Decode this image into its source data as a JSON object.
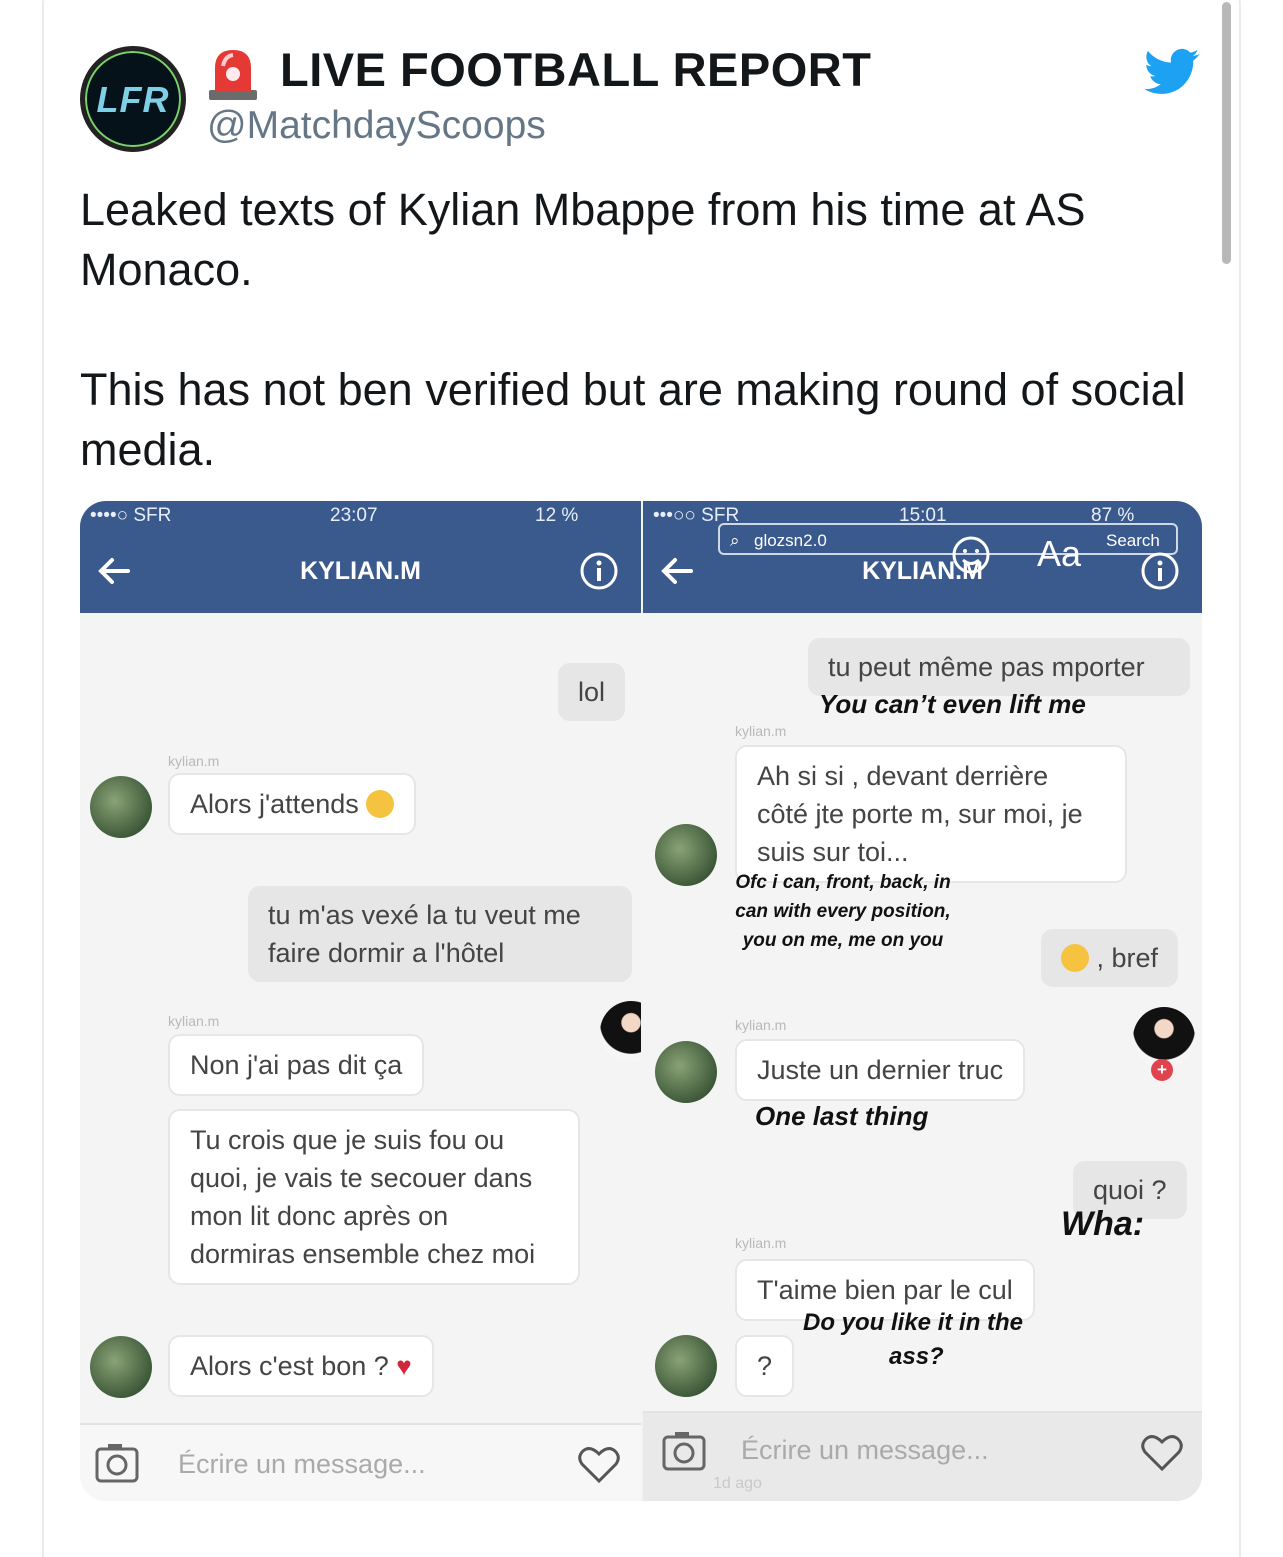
{
  "tweet": {
    "display_name": "LIVE FOOTBALL REPORT",
    "handle": "@MatchdayScoops",
    "avatar_text": "LFR",
    "text_paragraph_1": "Leaked texts of Kylian Mbappe from his time at AS Monaco.",
    "text_paragraph_2": "This has not ben verified but are making round of social media.",
    "icons": [
      "siren-emoji-icon",
      "twitter-bird-icon"
    ],
    "colors": {
      "twitter_blue": "#1da1f2",
      "handle_gray": "#657786",
      "messenger_blue": "#3a5a8d"
    }
  },
  "left_screenshot": {
    "status_carrier": "••••○ SFR",
    "status_time": "23:07",
    "status_battery": "12 %",
    "chat_title": "KYLIAN.M",
    "sender_label": "kylian.m",
    "messages": [
      {
        "text": "lol"
      },
      {
        "text": "Alors j'attends"
      },
      {
        "text": "tu m'as vexé la tu veut me faire dormir a l'hôtel"
      },
      {
        "text": "Non j'ai pas dit ça"
      },
      {
        "text": "Tu crois que je suis fou ou quoi, je vais te secouer dans mon lit donc après on dormiras ensemble chez moi"
      },
      {
        "text": "Alors c'est bon ?"
      }
    ],
    "compose_placeholder": "Écrire un message..."
  },
  "right_screenshot": {
    "status_carrier": "•••○○ SFR",
    "status_time": "15:01",
    "status_battery": "87 %",
    "search_text": "glozsn2.0",
    "aa_label": "Aa",
    "search_label": "Search",
    "chat_title": "KYLIAN.M",
    "sender_label": "kylian.m",
    "messages": [
      {
        "text": "tu peut même pas mporter",
        "caption": "You can’t even lift me"
      },
      {
        "text": "Ah si si , devant derrière côté jte porte m, sur moi, je suis sur toi...",
        "caption": "Ofc i can, front, back, in can with every position, you on me, me on you"
      },
      {
        "text": ", bref"
      },
      {
        "text": "Juste un dernier truc",
        "caption": "One last thing"
      },
      {
        "text": "quoi ?",
        "caption": "Wha:"
      },
      {
        "text": "T'aime bien par le cul",
        "caption": "Do you like it in the"
      },
      {
        "text": "?",
        "caption": "ass?"
      }
    ],
    "compose_placeholder": "Écrire un message...",
    "time_ago": "1d ago"
  }
}
